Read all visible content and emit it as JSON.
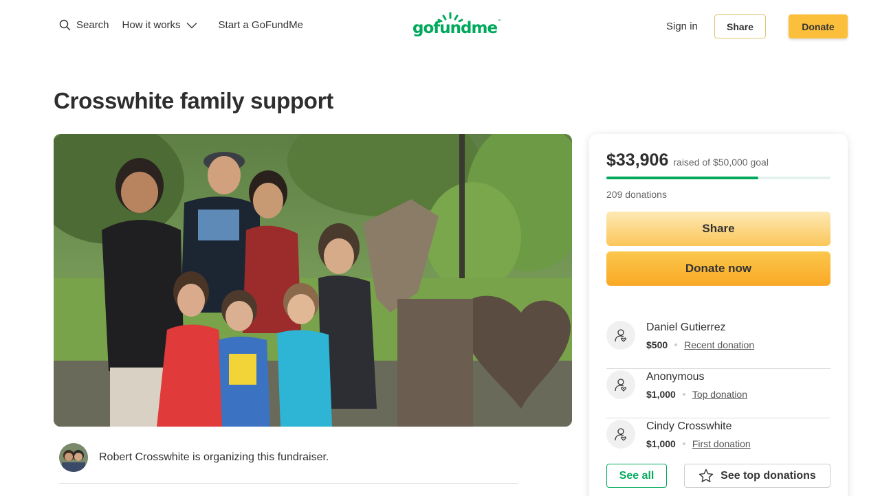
{
  "header": {
    "search_label": "Search",
    "how_it_works_label": "How it works",
    "start_label": "Start a GoFundMe",
    "logo_text": "gofundme",
    "sign_in_label": "Sign in",
    "share_label": "Share",
    "donate_label": "Donate"
  },
  "campaign": {
    "title": "Crosswhite family support",
    "organizer_text": "Robert Crosswhite is organizing this fundraiser."
  },
  "progress": {
    "amount": "$33,906",
    "goal_text": "raised of $50,000 goal",
    "fraction": 0.678,
    "donations_count": "209 donations"
  },
  "actions": {
    "share_label": "Share",
    "donate_now_label": "Donate now",
    "see_all_label": "See all",
    "see_top_label": "See top donations"
  },
  "donors": [
    {
      "name": "Daniel Gutierrez",
      "amount": "$500",
      "tag": "Recent donation"
    },
    {
      "name": "Anonymous",
      "amount": "$1,000",
      "tag": "Top donation"
    },
    {
      "name": "Cindy Crosswhite",
      "amount": "$1,000",
      "tag": "First donation"
    }
  ],
  "colors": {
    "brand_green": "#02a95c",
    "donate_yellow": "#fbbf3c",
    "text_dark": "#333333"
  },
  "icons": [
    "search-icon",
    "chevron-down-icon",
    "donor-heart-icon",
    "star-icon"
  ]
}
